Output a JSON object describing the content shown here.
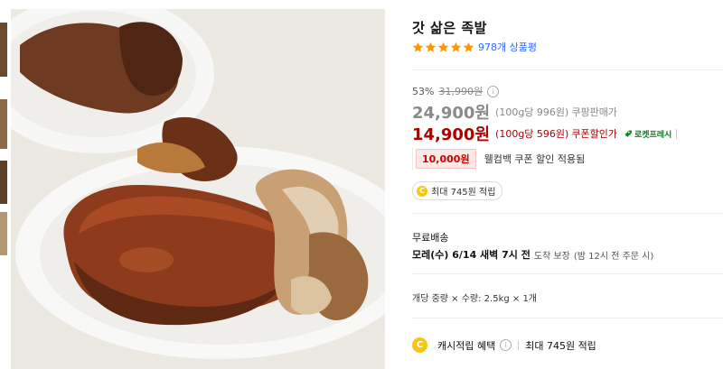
{
  "product": {
    "title": "갓 삶은 족발",
    "rating_stars": 5,
    "review_count": "978개 상품평"
  },
  "pricing": {
    "discount_rate": "53%",
    "original_price": "31,990원",
    "info_icon": "i",
    "sale_price": "24,900원",
    "sale_unit_price": "(100g당 996원)",
    "sale_tag": "쿠팡판매가",
    "coupon_price": "14,900원",
    "coupon_unit_price": "(100g당 596원)",
    "coupon_tag": "쿠폰할인가",
    "rocket_label": "로켓프레시"
  },
  "coupon": {
    "amount": "10,000원",
    "description": "웰컴백 쿠폰 할인 적용됨"
  },
  "reward": {
    "coin_symbol": "C",
    "text": "최대 745원 적립"
  },
  "shipping": {
    "label": "무료배송",
    "date_prefix": "모레(수) 6/14 새벽 7시 전",
    "guarantee": "도착 보장",
    "note": "(밤 12시 전 주문 시)"
  },
  "spec": {
    "text": "개당 중량 × 수량: 2.5kg × 1개"
  },
  "cash_reward": {
    "coin_symbol": "C",
    "label": "캐시적립 혜택",
    "info_icon": "i",
    "value": "최대 745원 적립"
  },
  "colors": {
    "star": "#ff9600",
    "link": "#346aff",
    "coupon_red": "#ae0000",
    "rocket_green": "#00891a",
    "coin_yellow": "#f5c518"
  },
  "icons": [
    "star-icon",
    "info-icon",
    "rocket-icon",
    "coin-icon"
  ]
}
